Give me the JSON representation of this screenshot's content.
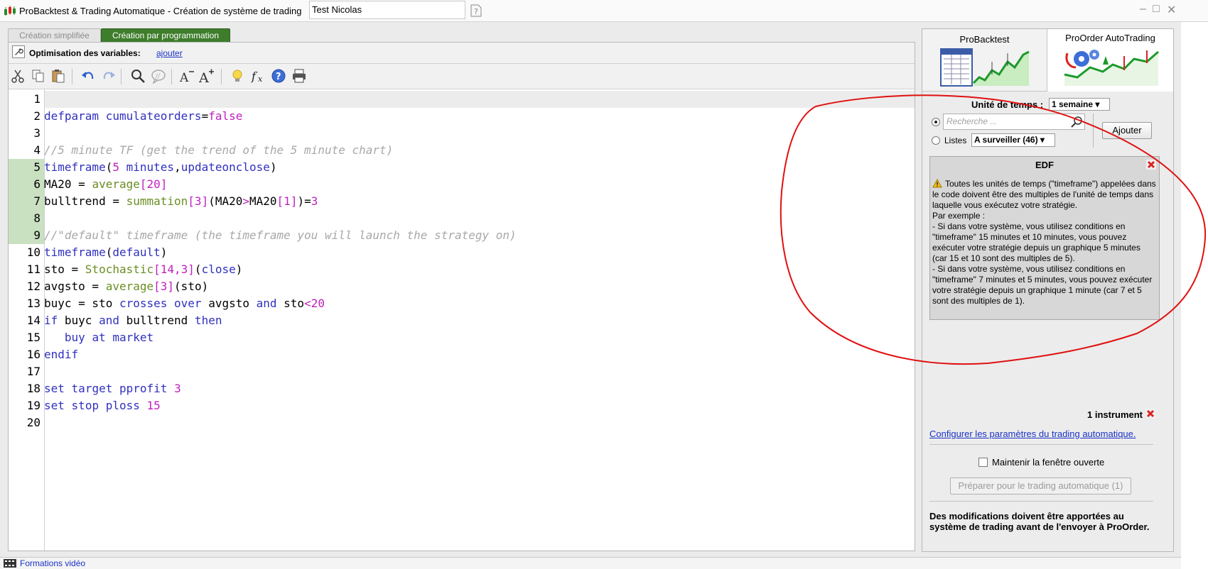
{
  "window": {
    "title": "ProBacktest & Trading Automatique - Création de système de trading",
    "system_name": "Test Nicolas",
    "controls": [
      "–",
      "□",
      "✕"
    ]
  },
  "tabs": [
    {
      "label": "Création simplifiée",
      "active": false
    },
    {
      "label": "Création par programmation",
      "active": true
    }
  ],
  "optimisation": {
    "label": "Optimisation des variables:",
    "link": "ajouter"
  },
  "toolbar": {
    "icons": [
      "cut-icon",
      "copy-icon",
      "paste-icon",
      "undo-icon",
      "redo-icon",
      "search-icon",
      "comment-icon",
      "font-decrease-icon",
      "font-increase-icon",
      "bulb-icon",
      "function-icon",
      "help-icon",
      "print-icon"
    ]
  },
  "editor": {
    "lines": [
      {
        "n": "1",
        "html": ""
      },
      {
        "n": "2",
        "html": "<span class=\"kw\">defparam</span> <span class=\"kw\">cumulateorders</span>=<span class=\"num\">false</span>"
      },
      {
        "n": "3",
        "html": ""
      },
      {
        "n": "4",
        "html": "<span class=\"cm\">//5 minute TF (get the trend of the 5 minute chart)</span>"
      },
      {
        "n": "5",
        "html": "<span class=\"kw\">timeframe</span>(<span class=\"num\">5</span> <span class=\"kw\">minutes</span>,<span class=\"kw\">updateonclose</span>)"
      },
      {
        "n": "6",
        "html": "MA20 = <span class=\"fn\">average</span><span class=\"num\">[20]</span>"
      },
      {
        "n": "7",
        "html": "bulltrend = <span class=\"fn\">summation</span><span class=\"num\">[3]</span>(MA20<span class=\"num\">&gt;</span>MA20<span class=\"num\">[1]</span>)=<span class=\"num\">3</span>"
      },
      {
        "n": "8",
        "html": ""
      },
      {
        "n": "9",
        "html": "<span class=\"cm\">//\"default\" timeframe (the timeframe you will launch the strategy on)</span>"
      },
      {
        "n": "10",
        "html": "<span class=\"kw\">timeframe</span>(<span class=\"kw\">default</span>)"
      },
      {
        "n": "11",
        "html": "sto = <span class=\"fn\">Stochastic</span><span class=\"num\">[14,3]</span>(<span class=\"kw\">close</span>)"
      },
      {
        "n": "12",
        "html": "avgsto = <span class=\"fn\">average</span><span class=\"num\">[3]</span>(sto)"
      },
      {
        "n": "13",
        "html": "buyc = sto <span class=\"kw\">crosses over</span> avgsto <span class=\"kw\">and</span> sto<span class=\"num\">&lt;20</span>"
      },
      {
        "n": "14",
        "html": "<span class=\"kw\">if</span> buyc <span class=\"kw\">and</span> bulltrend <span class=\"kw\">then</span>"
      },
      {
        "n": "15",
        "html": "   <span class=\"kw\">buy</span> <span class=\"kw\">at</span> <span class=\"kw\">market</span>"
      },
      {
        "n": "16",
        "html": "<span class=\"kw\">endif</span>"
      },
      {
        "n": "17",
        "html": ""
      },
      {
        "n": "18",
        "html": "<span class=\"kw\">set</span> <span class=\"kw\">target</span> <span class=\"kw\">pprofit</span> <span class=\"num\">3</span>"
      },
      {
        "n": "19",
        "html": "<span class=\"kw\">set</span> <span class=\"kw\">stop</span> <span class=\"kw\">ploss</span> <span class=\"num\">15</span>"
      },
      {
        "n": "20",
        "html": ""
      }
    ]
  },
  "right": {
    "tab_backtest": "ProBacktest",
    "tab_autotrading": "ProOrder AutoTrading",
    "timeunit_label": "Unité de temps :",
    "timeunit_value": "1 semaine ▾",
    "search_placeholder": "Recherche ...",
    "lists_label": "Listes",
    "lists_value": "A surveiller (46) ▾",
    "add_button": "Ajouter",
    "edf_title": "EDF",
    "edf_text_html": "Toutes les unités de temps (\"timeframe\") appelées dans le code doivent être des multiples de l'unité de temps dans laquelle vous exécutez votre stratégie.<br>Par exemple :<br>- Si dans votre système, vous utilisez conditions en \"timeframe\" 15 minutes et 10 minutes, vous pouvez exécuter votre stratégie depuis un graphique 5 minutes (car 15 et 10 sont des multiples de 5).<br>- Si dans votre système, vous utilisez conditions en \"timeframe\" 7 minutes et 5 minutes, vous pouvez exécuter votre stratégie depuis un graphique 1 minute (car 7 et 5 sont des multiples de 1).",
    "instrument_count": "1 instrument",
    "config_link": "Configurer les paramètres du trading automatique.",
    "keep_open_label": "Maintenir la fenêtre ouverte",
    "prepare_button": "Préparer pour le trading automatique (1)",
    "mods_text": "Des modifications doivent être apportées au système de trading avant de l'envoyer à ProOrder."
  },
  "status": {
    "video_link": "Formations vidéo"
  },
  "colors": {
    "active_tab": "#3e7d2c",
    "link": "#1a32c8",
    "keyword": "#3030c0",
    "function": "#6b8e23",
    "number": "#c020c0",
    "comment": "#a8a8a8",
    "gutter_highlight": "#c9e0c1",
    "annotation": "#e01010"
  }
}
